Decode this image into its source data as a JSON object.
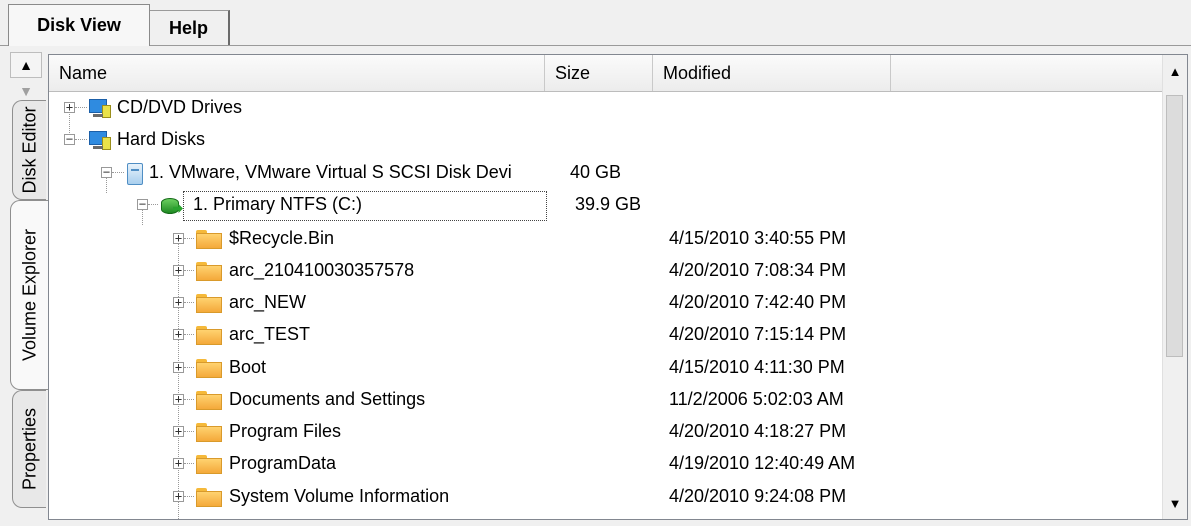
{
  "tabs": {
    "disk_view": "Disk View",
    "help": "Help"
  },
  "side_tabs": {
    "disk_editor": "Disk Editor",
    "volume_explorer": "Volume Explorer",
    "properties": "Properties"
  },
  "columns": {
    "name": "Name",
    "size": "Size",
    "modified": "Modified"
  },
  "tree": {
    "cd_dvd": {
      "name": "CD/DVD Drives",
      "expander": "+"
    },
    "hard_disks": {
      "name": "Hard Disks",
      "expander": "−"
    },
    "disk1": {
      "name": "1. VMware, VMware Virtual S SCSI Disk Devi",
      "size": "40 GB",
      "expander": "−"
    },
    "vol1": {
      "name": "1. Primary NTFS (C:)",
      "size": "39.9 GB",
      "expander": "−"
    },
    "folders": [
      {
        "name": "$Recycle.Bin",
        "modified": "4/15/2010 3:40:55 PM"
      },
      {
        "name": "arc_210410030357578",
        "modified": "4/20/2010 7:08:34 PM"
      },
      {
        "name": "arc_NEW",
        "modified": "4/20/2010 7:42:40 PM"
      },
      {
        "name": "arc_TEST",
        "modified": "4/20/2010 7:15:14 PM"
      },
      {
        "name": "Boot",
        "modified": "4/15/2010 4:11:30 PM"
      },
      {
        "name": "Documents and Settings",
        "modified": "11/2/2006 5:02:03 AM"
      },
      {
        "name": "Program Files",
        "modified": "4/20/2010 4:18:27 PM"
      },
      {
        "name": "ProgramData",
        "modified": "4/19/2010 12:40:49 AM"
      },
      {
        "name": "System Volume Information",
        "modified": "4/20/2010 9:24:08 PM"
      }
    ]
  },
  "icons": {
    "monitor": "computer-monitor-icon",
    "disk": "hard-disk-icon",
    "volume": "ntfs-volume-icon",
    "folder": "folder-icon"
  }
}
